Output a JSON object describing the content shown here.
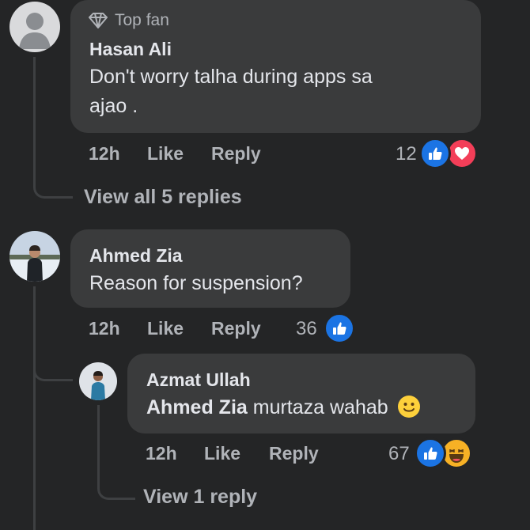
{
  "comments": [
    {
      "badge": "Top fan",
      "author": "Hasan Ali",
      "text_line1": "Don't worry talha during apps sa",
      "text_line2": "ajao .",
      "time": "12h",
      "like": "Like",
      "reply": "Reply",
      "reaction_count": "12",
      "reactions": [
        "like-icon",
        "love-icon"
      ],
      "view_replies": "View all 5 replies"
    },
    {
      "author": "Ahmed Zia",
      "text": "Reason for suspension?",
      "time": "12h",
      "like": "Like",
      "reply": "Reply",
      "reaction_count": "36",
      "reactions": [
        "like-icon"
      ]
    }
  ],
  "reply": {
    "author": "Azmat Ullah",
    "mention": "Ahmed Zia",
    "text": "murtaza wahab",
    "emoji": "🙂",
    "time": "12h",
    "like": "Like",
    "reply": "Reply",
    "reaction_count": "67",
    "reactions": [
      "like-icon",
      "haha-icon"
    ],
    "view_replies": "View 1 reply"
  },
  "colors": {
    "background": "#242526",
    "bubble": "#3a3b3c",
    "like_blue": "#1b74e4",
    "love_red": "#f33e58",
    "haha_yellow": "#f7b125"
  }
}
